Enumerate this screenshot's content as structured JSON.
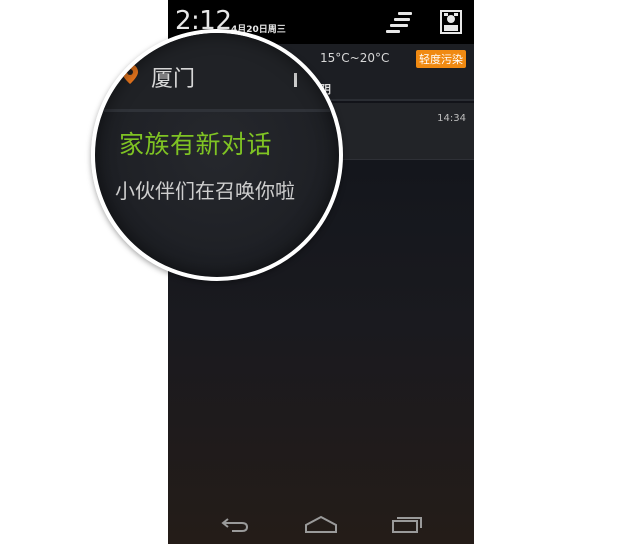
{
  "status_bar": {
    "time": "2:12",
    "date": "4月20日周三"
  },
  "weather": {
    "temperature": "15°C~20°C",
    "pollution_badge": "轻度污染",
    "condition": "阴",
    "city": "厦门"
  },
  "notification": {
    "time": "14:34",
    "title": "家族有新对话",
    "message": "小伙伴们在召唤你啦",
    "message_tail": "~"
  },
  "colors": {
    "accent_green": "#7fc323",
    "pollution_orange": "#f08a12",
    "pin_orange": "#f07a1e"
  },
  "icons": {
    "quick_settings": "quick-settings-icon",
    "settings": "settings-icon",
    "location": "location-pin-icon",
    "back": "back-icon",
    "home": "home-icon",
    "recents": "recents-icon"
  }
}
